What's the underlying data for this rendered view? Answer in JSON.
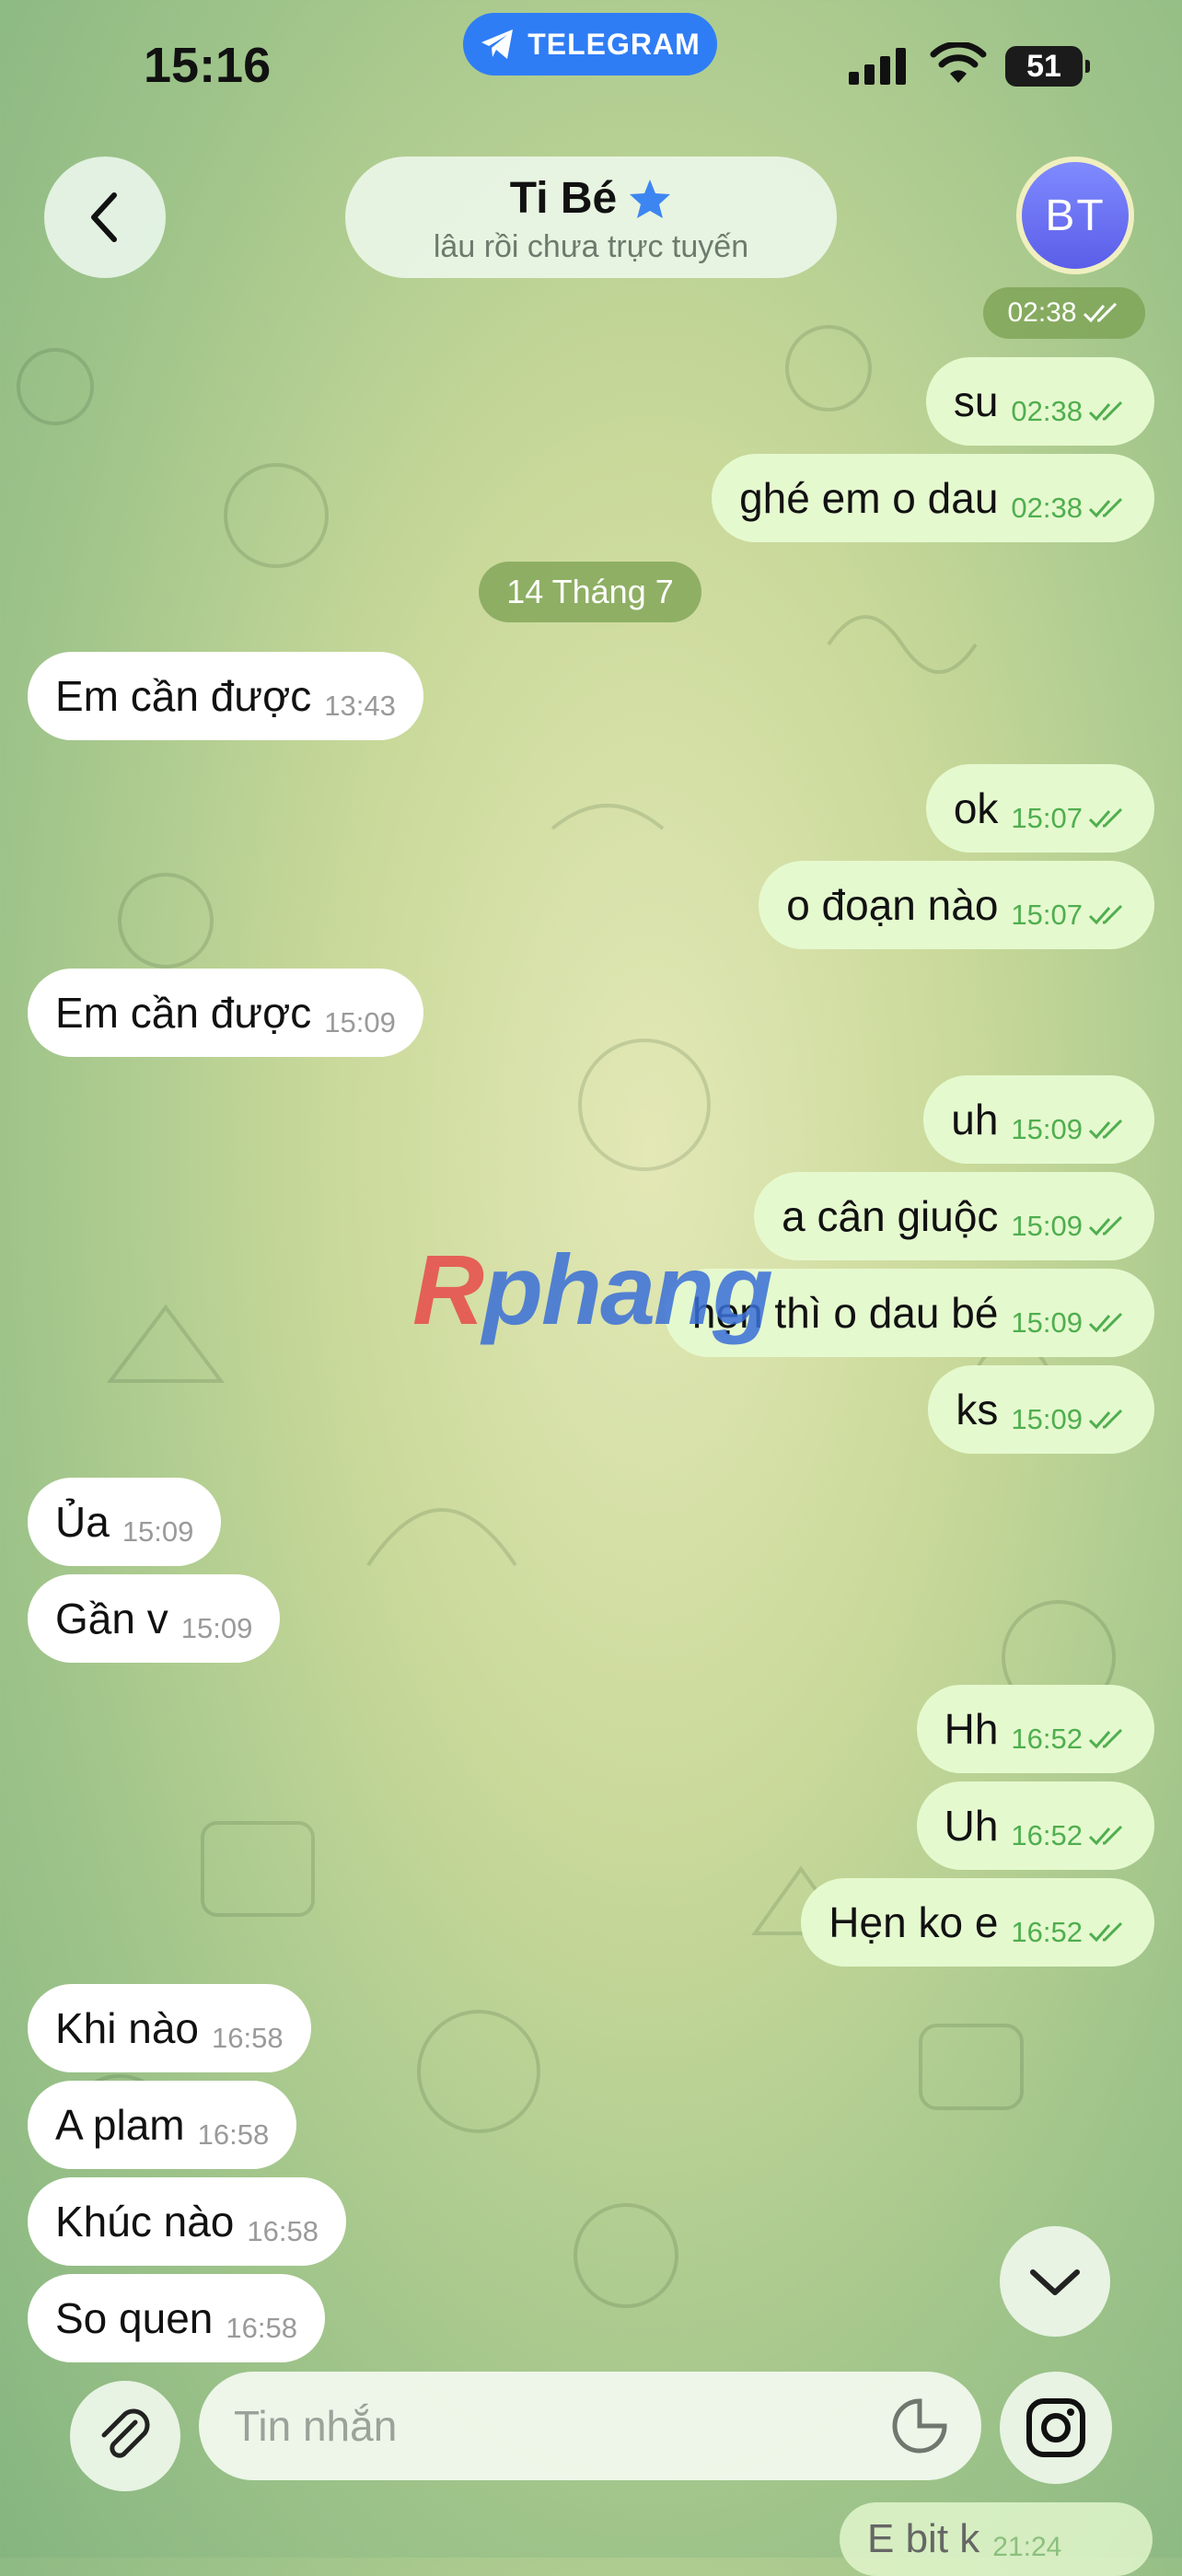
{
  "status_bar": {
    "time": "15:16",
    "app_pill": "TELEGRAM",
    "battery": "51"
  },
  "header": {
    "back_icon": "chevron-left-icon",
    "title": "Ti Bé",
    "subtitle": "lâu rồi chưa trực tuyến",
    "avatar_initials": "BT",
    "verified_icon": "star-icon"
  },
  "top_time_chip": "02:38",
  "date_chip": "14 Tháng 7",
  "messages": [
    {
      "dir": "out",
      "text": "su",
      "time": "02:38"
    },
    {
      "dir": "out",
      "text": "ghé em o dau",
      "time": "02:38"
    },
    {
      "dir": "in",
      "text": "Em cần được",
      "time": "13:43"
    },
    {
      "dir": "out",
      "text": "ok",
      "time": "15:07"
    },
    {
      "dir": "out",
      "text": "o đoạn nào",
      "time": "15:07"
    },
    {
      "dir": "in",
      "text": "Em cần được",
      "time": "15:09"
    },
    {
      "dir": "out",
      "text": "uh",
      "time": "15:09"
    },
    {
      "dir": "out",
      "text": "a cân giuộc",
      "time": "15:09"
    },
    {
      "dir": "out",
      "text": "hẹn thì o dau bé",
      "time": "15:09"
    },
    {
      "dir": "out",
      "text": "ks",
      "time": "15:09"
    },
    {
      "dir": "in",
      "text": "Ủa",
      "time": "15:09"
    },
    {
      "dir": "in",
      "text": "Gần v",
      "time": "15:09"
    },
    {
      "dir": "out",
      "text": "Hh",
      "time": "16:52"
    },
    {
      "dir": "out",
      "text": "Uh",
      "time": "16:52"
    },
    {
      "dir": "out",
      "text": "Hẹn ko e",
      "time": "16:52"
    },
    {
      "dir": "in",
      "text": "Khi nào",
      "time": "16:58"
    },
    {
      "dir": "in",
      "text": "A plam",
      "time": "16:58"
    },
    {
      "dir": "in",
      "text": "Khúc nào",
      "time": "16:58"
    },
    {
      "dir": "in",
      "text": "So quen",
      "time": "16:58"
    }
  ],
  "watermark": {
    "first": "R",
    "rest": "phang"
  },
  "composer": {
    "placeholder": "Tin nhắn",
    "attach_icon": "paperclip-icon",
    "sticker_icon": "sticker-icon",
    "camera_icon": "instagram-camera-icon",
    "scroll_icon": "chevron-down-icon"
  },
  "partial_bottom_message": {
    "text": "E bit k",
    "time": "21:24"
  },
  "colors": {
    "out_bubble": "#e5f9cf",
    "in_bubble": "#ffffff",
    "read_tick": "#4fae4e",
    "telegram_blue": "#2f7df5"
  }
}
